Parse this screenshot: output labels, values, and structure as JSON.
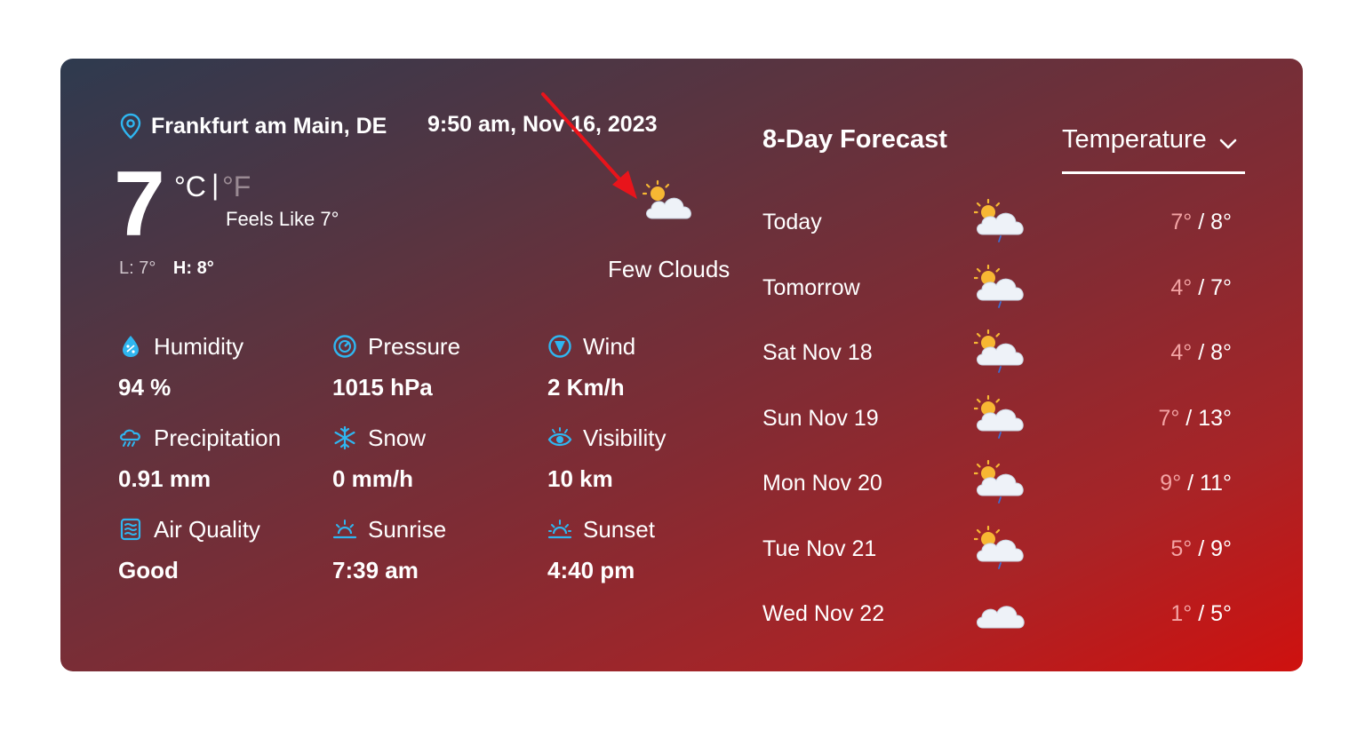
{
  "current": {
    "location": "Frankfurt am Main, DE",
    "datetime": "9:50 am, Nov 16, 2023",
    "temperature": "7",
    "unit_c": "°C",
    "unit_separator": "|",
    "unit_f": "°F",
    "feels_like": "Feels Like 7°",
    "low": "L: 7°",
    "high": "H: 8°",
    "condition": "Few Clouds",
    "condition_icon": "few-clouds-icon"
  },
  "metrics": [
    {
      "label": "Humidity",
      "value": "94 %",
      "icon": "humidity-icon"
    },
    {
      "label": "Pressure",
      "value": "1015 hPa",
      "icon": "pressure-icon"
    },
    {
      "label": "Wind",
      "value": "2 Km/h",
      "icon": "wind-icon"
    },
    {
      "label": "Precipitation",
      "value": "0.91 mm",
      "icon": "precipitation-icon"
    },
    {
      "label": "Snow",
      "value": "0 mm/h",
      "icon": "snowflake-icon"
    },
    {
      "label": "Visibility",
      "value": "10 km",
      "icon": "eye-icon"
    },
    {
      "label": "Air Quality",
      "value": "Good",
      "icon": "air-quality-icon"
    },
    {
      "label": "Sunrise",
      "value": "7:39 am",
      "icon": "sunrise-icon"
    },
    {
      "label": "Sunset",
      "value": "4:40 pm",
      "icon": "sunset-icon"
    }
  ],
  "forecast": {
    "title": "8-Day Forecast",
    "selector": "Temperature",
    "days": [
      {
        "day": "Today",
        "low": "7°",
        "high": "8°",
        "icon": "rain-sun-icon"
      },
      {
        "day": "Tomorrow",
        "low": "4°",
        "high": "7°",
        "icon": "rain-sun-icon"
      },
      {
        "day": "Sat Nov 18",
        "low": "4°",
        "high": "8°",
        "icon": "rain-sun-icon"
      },
      {
        "day": "Sun Nov 19",
        "low": "7°",
        "high": "13°",
        "icon": "rain-sun-icon"
      },
      {
        "day": "Mon Nov 20",
        "low": "9°",
        "high": "11°",
        "icon": "rain-sun-icon"
      },
      {
        "day": "Tue Nov 21",
        "low": "5°",
        "high": "9°",
        "icon": "rain-sun-icon"
      },
      {
        "day": "Wed Nov 22",
        "low": "1°",
        "high": "5°",
        "icon": "cloud-icon"
      }
    ]
  },
  "colors": {
    "accent_icon": "#2fb6f0",
    "arrow": "#e8141b",
    "low_temp": "#f3a4a4"
  }
}
